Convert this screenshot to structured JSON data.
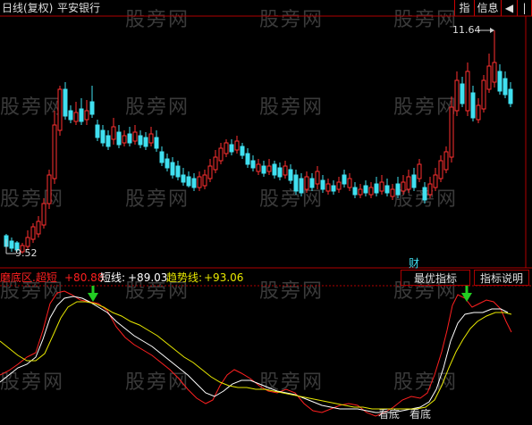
{
  "header": {
    "chart_title": "日线(复权)",
    "stock_name": "平安银行",
    "btn_index": "指",
    "btn_info": "信息"
  },
  "watermark": "股旁网",
  "price_marks": {
    "high": "11.64",
    "low": "9.52"
  },
  "cai_label": "财",
  "indicator": {
    "name": "磨底区.超短",
    "name_value": "+80.88",
    "short_line_label": "短线:",
    "short_line_value": "+89.03",
    "trend_line_label": "趋势线:",
    "trend_line_value": "+93.06",
    "best_button": "最优指标",
    "explain_button": "指标说明"
  },
  "signals": [
    "看底",
    "看底"
  ],
  "colors": {
    "up": "#ff3030",
    "down": "#40e0f0",
    "grid": "#b00000",
    "short_line": "#ffffff",
    "trend_line": "#e8e800",
    "ultra_line": "#ff2020",
    "arrow": "#22cc22"
  }
}
